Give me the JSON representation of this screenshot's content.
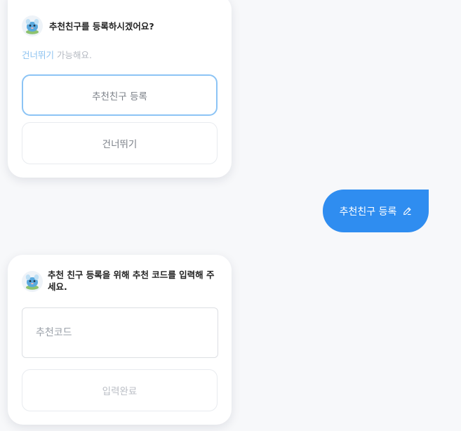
{
  "card1": {
    "title": "추천친구를 등록하시겠어요?",
    "skip_link": "건너뛰기",
    "skip_note": " 가능해요.",
    "register_button": "추천친구 등록",
    "skip_button": "건너뛰기"
  },
  "user_message": {
    "text": "추천친구 등록"
  },
  "card2": {
    "title": "추천 친구 등록을 위해 추천 코드를 입력해 주세요.",
    "code_placeholder": "추천코드",
    "complete_button": "입력완료"
  },
  "colors": {
    "accent": "#2f8df0",
    "link": "#8cc2f0",
    "selected_border": "#8cc4f5",
    "background": "#f7f8fa"
  },
  "icons": {
    "avatar": "mascot-avatar-icon",
    "edit": "pencil-icon"
  }
}
